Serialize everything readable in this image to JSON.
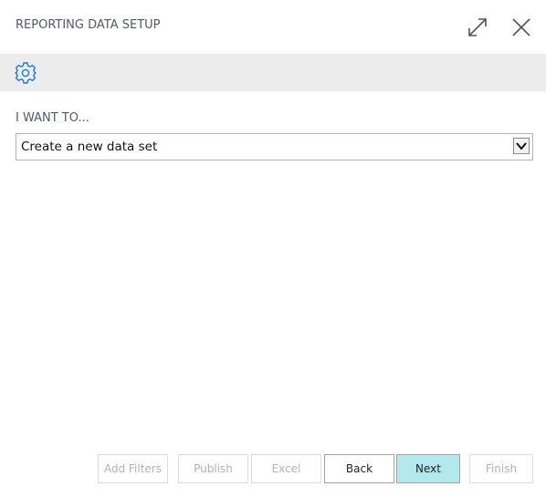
{
  "window": {
    "title": "REPORTING DATA SETUP",
    "expand_icon": "expand-icon",
    "close_icon": "close-icon"
  },
  "action_bar": {
    "settings_icon": "gear-icon",
    "accent_color": "#1e7ad0"
  },
  "form": {
    "label": "I WANT TO...",
    "select": {
      "value": "Create a new data set"
    }
  },
  "footer": {
    "buttons": [
      {
        "label": "Add Filters",
        "enabled": false
      },
      {
        "label": "Publish",
        "enabled": false
      },
      {
        "label": "Excel",
        "enabled": false
      },
      {
        "label": "Back",
        "enabled": true
      },
      {
        "label": "Next",
        "enabled": true,
        "primary": true
      },
      {
        "label": "Finish",
        "enabled": false
      }
    ],
    "primary_color": "#b3e8ec"
  }
}
